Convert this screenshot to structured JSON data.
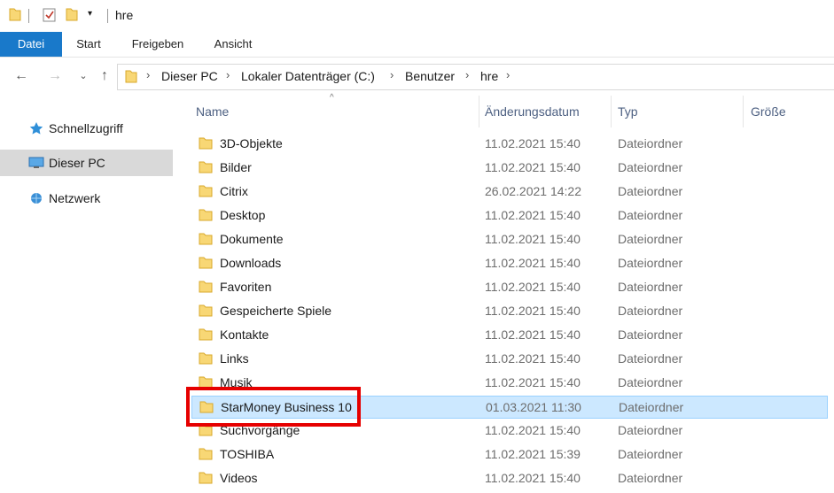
{
  "window": {
    "title": "hre"
  },
  "ribbon": {
    "tabs": [
      {
        "label": "Datei"
      },
      {
        "label": "Start"
      },
      {
        "label": "Freigeben"
      },
      {
        "label": "Ansicht"
      }
    ]
  },
  "address": {
    "crumbs": [
      "Dieser PC",
      "Lokaler Datenträger (C:)",
      "Benutzer",
      "hre"
    ]
  },
  "sidebar": {
    "items": [
      {
        "label": "Schnellzugriff",
        "icon": "star-icon"
      },
      {
        "label": "Dieser PC",
        "icon": "computer-icon"
      },
      {
        "label": "Netzwerk",
        "icon": "network-icon"
      }
    ]
  },
  "columns": {
    "name": "Name",
    "date": "Änderungsdatum",
    "type": "Typ",
    "size": "Größe"
  },
  "files": [
    {
      "name": "3D-Objekte",
      "date": "11.02.2021 15:40",
      "type": "Dateiordner",
      "icon": "3d-objects-folder-icon"
    },
    {
      "name": "Bilder",
      "date": "11.02.2021 15:40",
      "type": "Dateiordner",
      "icon": "pictures-folder-icon"
    },
    {
      "name": "Citrix",
      "date": "26.02.2021 14:22",
      "type": "Dateiordner",
      "icon": "folder-icon"
    },
    {
      "name": "Desktop",
      "date": "11.02.2021 15:40",
      "type": "Dateiordner",
      "icon": "desktop-folder-icon"
    },
    {
      "name": "Dokumente",
      "date": "11.02.2021 15:40",
      "type": "Dateiordner",
      "icon": "documents-folder-icon"
    },
    {
      "name": "Downloads",
      "date": "11.02.2021 15:40",
      "type": "Dateiordner",
      "icon": "downloads-folder-icon"
    },
    {
      "name": "Favoriten",
      "date": "11.02.2021 15:40",
      "type": "Dateiordner",
      "icon": "favorites-folder-icon"
    },
    {
      "name": "Gespeicherte Spiele",
      "date": "11.02.2021 15:40",
      "type": "Dateiordner",
      "icon": "saved-games-folder-icon"
    },
    {
      "name": "Kontakte",
      "date": "11.02.2021 15:40",
      "type": "Dateiordner",
      "icon": "contacts-folder-icon"
    },
    {
      "name": "Links",
      "date": "11.02.2021 15:40",
      "type": "Dateiordner",
      "icon": "links-folder-icon"
    },
    {
      "name": "Musik",
      "date": "11.02.2021 15:40",
      "type": "Dateiordner",
      "icon": "music-folder-icon"
    },
    {
      "name": "StarMoney Business 10",
      "date": "01.03.2021 11:30",
      "type": "Dateiordner",
      "icon": "folder-icon",
      "selected": true
    },
    {
      "name": "Suchvorgänge",
      "date": "11.02.2021 15:40",
      "type": "Dateiordner",
      "icon": "searches-folder-icon"
    },
    {
      "name": "TOSHIBA",
      "date": "11.02.2021 15:39",
      "type": "Dateiordner",
      "icon": "folder-icon"
    },
    {
      "name": "Videos",
      "date": "11.02.2021 15:40",
      "type": "Dateiordner",
      "icon": "videos-folder-icon"
    }
  ],
  "colors": {
    "accent": "#1979ca",
    "folder": "#f8d775",
    "selection": "#cce8ff",
    "highlight": "#e60000"
  }
}
